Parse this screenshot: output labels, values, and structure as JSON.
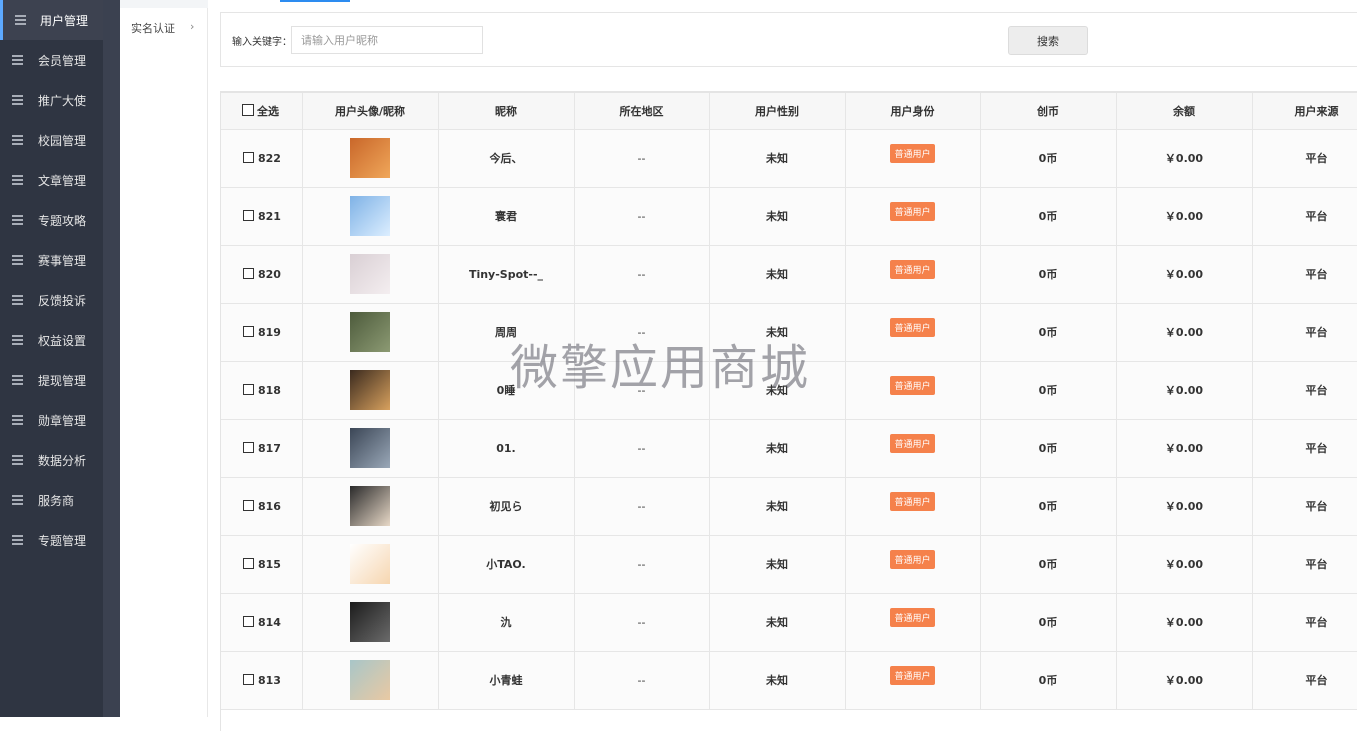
{
  "sidebar": {
    "items": [
      {
        "label": "用户管理",
        "active": true
      },
      {
        "label": "会员管理"
      },
      {
        "label": "推广大使"
      },
      {
        "label": "校园管理"
      },
      {
        "label": "文章管理"
      },
      {
        "label": "专题攻略"
      },
      {
        "label": "赛事管理"
      },
      {
        "label": "反馈投诉"
      },
      {
        "label": "权益设置"
      },
      {
        "label": "提现管理"
      },
      {
        "label": "勋章管理"
      },
      {
        "label": "数据分析"
      },
      {
        "label": "服务商"
      },
      {
        "label": "专题管理"
      }
    ]
  },
  "subnav": {
    "item_label": "实名认证",
    "arrow": "›"
  },
  "search": {
    "label": "输入关键字：",
    "placeholder": "请输入用户昵称",
    "button_label": "搜索"
  },
  "table": {
    "headers": {
      "select_all": "全选",
      "avatar": "用户头像/昵称",
      "nickname": "昵称",
      "region": "所在地区",
      "gender": "用户性别",
      "identity": "用户身份",
      "coin": "创币",
      "balance": "余额",
      "source": "用户来源"
    },
    "rows": [
      {
        "id": "822",
        "nickname": "今后、",
        "region": "--",
        "gender": "未知",
        "identity": "普通用户",
        "coin": "0币",
        "balance": "￥0.00",
        "source": "平台",
        "avatar_colors": [
          "#c9672a",
          "#f0a75a"
        ]
      },
      {
        "id": "821",
        "nickname": "寰君",
        "region": "--",
        "gender": "未知",
        "identity": "普通用户",
        "coin": "0币",
        "balance": "￥0.00",
        "source": "平台",
        "avatar_colors": [
          "#7fb2e6",
          "#dceeff"
        ]
      },
      {
        "id": "820",
        "nickname": "Tiny-Spot--_",
        "region": "--",
        "gender": "未知",
        "identity": "普通用户",
        "coin": "0币",
        "balance": "￥0.00",
        "source": "平台",
        "avatar_colors": [
          "#d9cfd4",
          "#f4eef0"
        ]
      },
      {
        "id": "819",
        "nickname": "周周",
        "region": "--",
        "gender": "未知",
        "identity": "普通用户",
        "coin": "0币",
        "balance": "￥0.00",
        "source": "平台",
        "avatar_colors": [
          "#4d5b3c",
          "#8c9a73"
        ]
      },
      {
        "id": "818",
        "nickname": "0睡",
        "region": "--",
        "gender": "未知",
        "identity": "普通用户",
        "coin": "0币",
        "balance": "￥0.00",
        "source": "平台",
        "avatar_colors": [
          "#3a2a1e",
          "#d8a15e"
        ]
      },
      {
        "id": "817",
        "nickname": "01.",
        "region": "--",
        "gender": "未知",
        "identity": "普通用户",
        "coin": "0币",
        "balance": "￥0.00",
        "source": "平台",
        "avatar_colors": [
          "#3b4656",
          "#9aa8b8"
        ]
      },
      {
        "id": "816",
        "nickname": "初见ら",
        "region": "--",
        "gender": "未知",
        "identity": "普通用户",
        "coin": "0币",
        "balance": "￥0.00",
        "source": "平台",
        "avatar_colors": [
          "#2a2a2a",
          "#e8d9c8"
        ]
      },
      {
        "id": "815",
        "nickname": "小TAO.",
        "region": "--",
        "gender": "未知",
        "identity": "普通用户",
        "coin": "0币",
        "balance": "￥0.00",
        "source": "平台",
        "avatar_colors": [
          "#ffffff",
          "#f6d6b0"
        ]
      },
      {
        "id": "814",
        "nickname": "氿",
        "region": "--",
        "gender": "未知",
        "identity": "普通用户",
        "coin": "0币",
        "balance": "￥0.00",
        "source": "平台",
        "avatar_colors": [
          "#1c1c1c",
          "#6b6b6b"
        ]
      },
      {
        "id": "813",
        "nickname": "小青蛙",
        "region": "--",
        "gender": "未知",
        "identity": "普通用户",
        "coin": "0币",
        "balance": "￥0.00",
        "source": "平台",
        "avatar_colors": [
          "#a8c6c8",
          "#e9c9a3"
        ]
      }
    ]
  },
  "watermark": "微擎应用商城",
  "colors": {
    "sidebar_bg": "#2f3542",
    "badge": "#f5814b",
    "accent": "#2d8cf0"
  }
}
